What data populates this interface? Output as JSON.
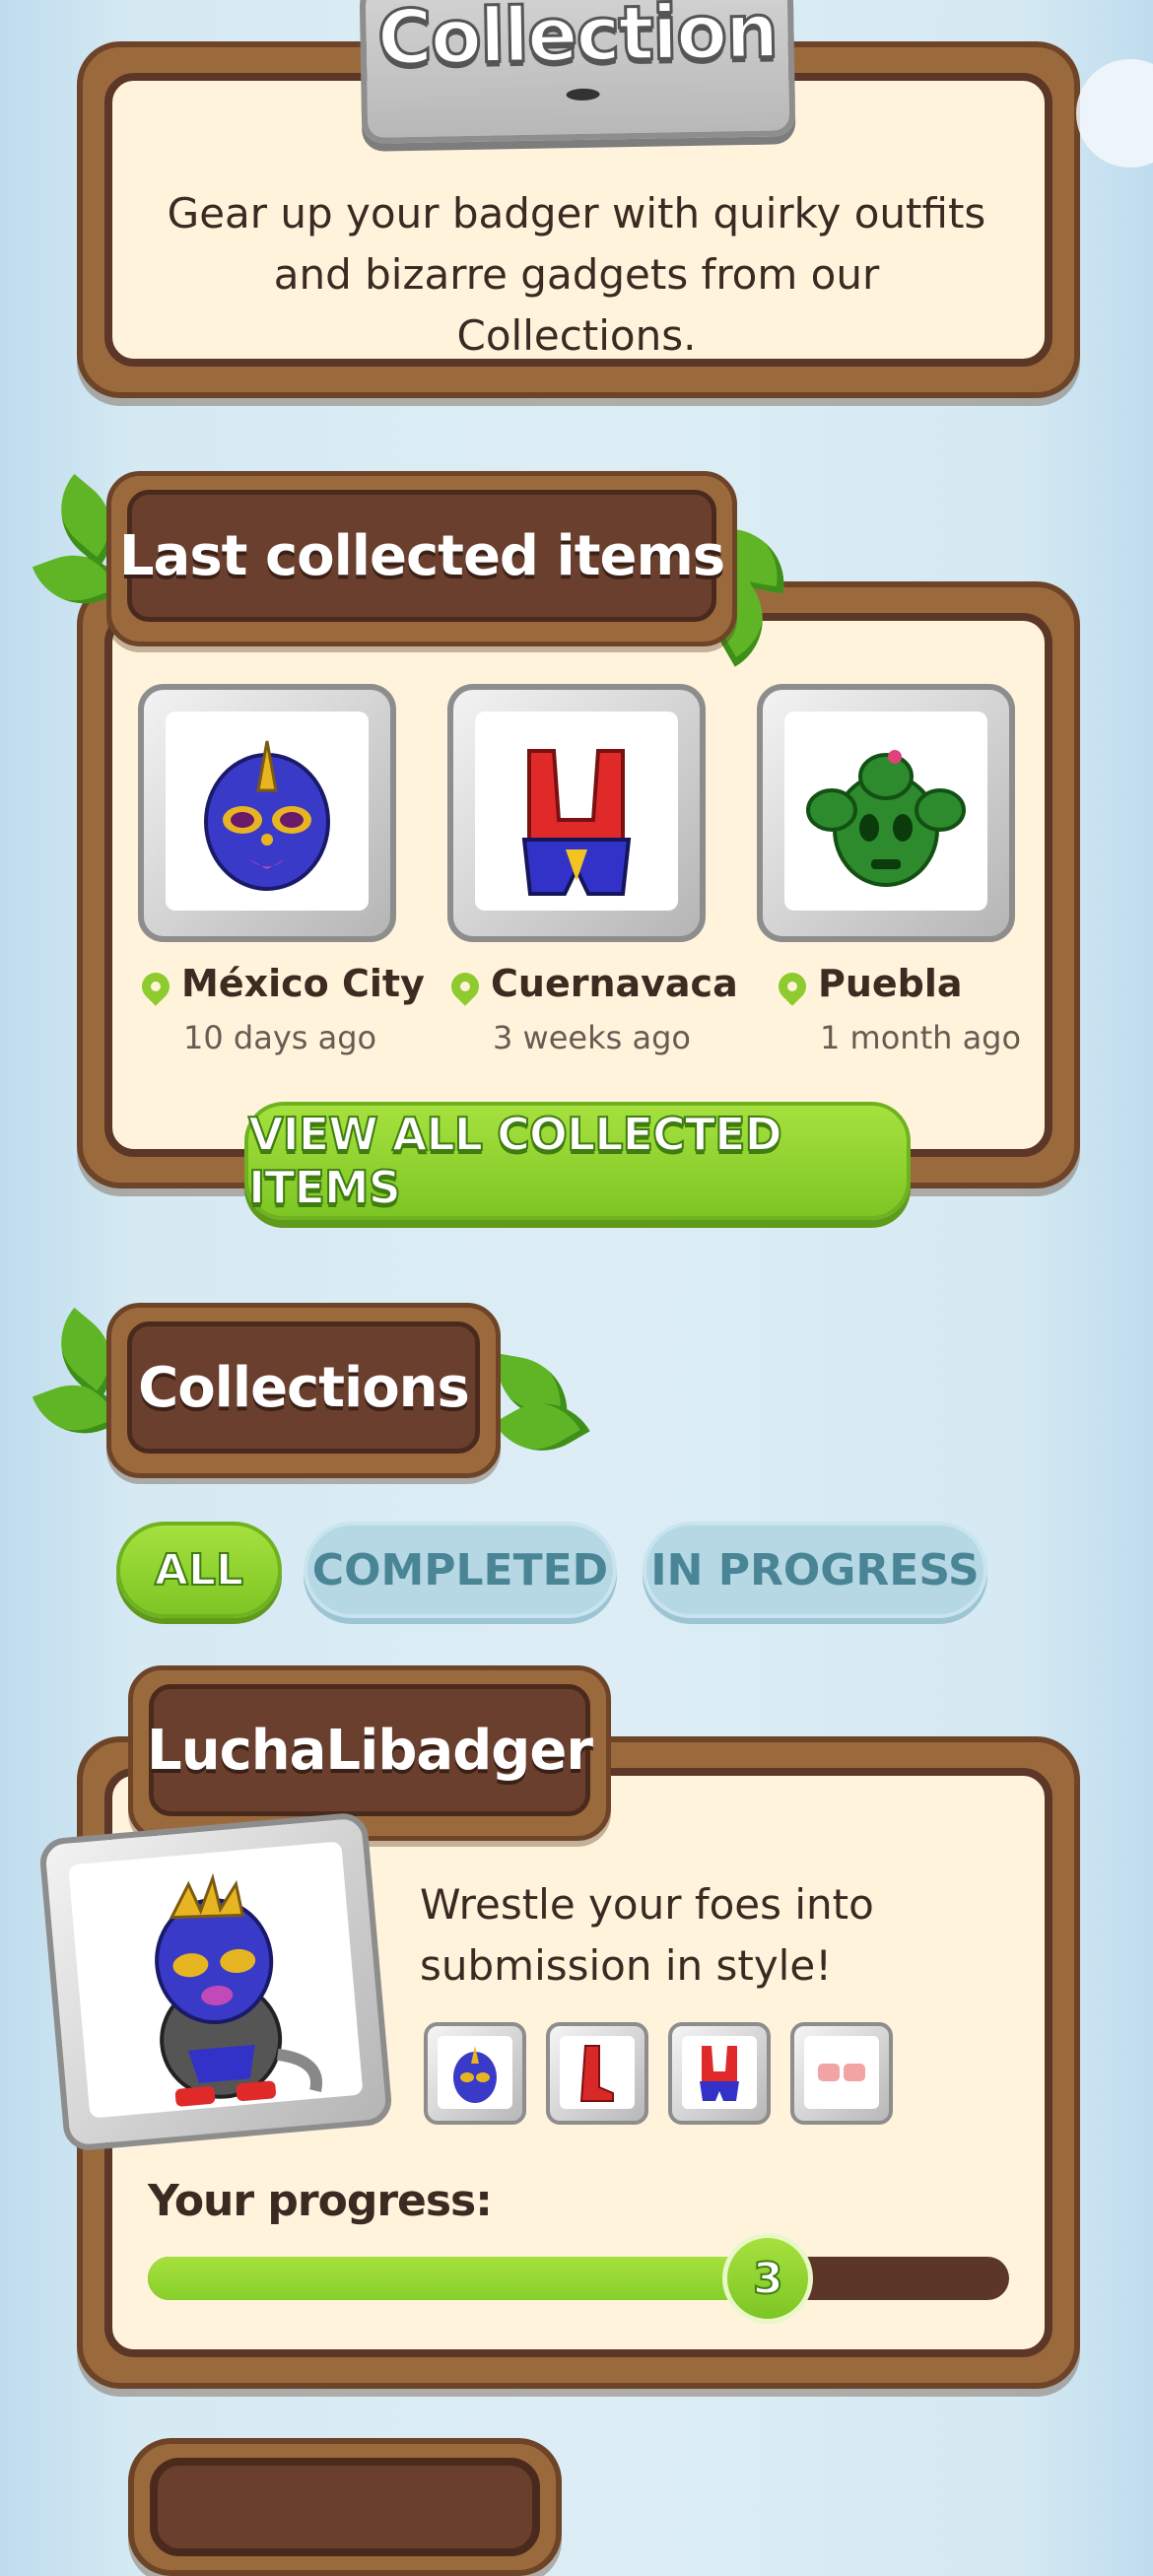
{
  "header": {
    "title": "Collection",
    "description": "Gear up your badger with quirky outfits and bizarre gadgets from our Collections."
  },
  "last_collected": {
    "title": "Last collected items",
    "items": [
      {
        "city": "México City",
        "ago": "10 days ago",
        "icon": "wrestling-mask-icon"
      },
      {
        "city": "Cuernavaca",
        "ago": "3 weeks ago",
        "icon": "wrestling-outfit-icon"
      },
      {
        "city": "Puebla",
        "ago": "1 month ago",
        "icon": "cactus-mask-icon"
      }
    ],
    "view_all_label": "VIEW ALL COLLECTED ITEMS"
  },
  "collections": {
    "title": "Collections",
    "tabs": [
      {
        "label": "ALL",
        "active": true
      },
      {
        "label": "COMPLETED",
        "active": false
      },
      {
        "label": "IN PROGRESS",
        "active": false
      }
    ]
  },
  "collection_card": {
    "name": "LuchaLibadger",
    "description": "Wrestle your foes into submission in style!",
    "items": [
      "wrestling-mask-icon",
      "red-boots-icon",
      "wrestling-outfit-icon",
      "pink-wristbands-icon"
    ],
    "progress_label": "Your progress:",
    "progress_value": "3",
    "progress_fraction": 0.72
  },
  "colors": {
    "wood": "#9b6a3c",
    "wood_dark": "#5c3626",
    "cream": "#fff3dc",
    "accent_green": "#8dcb2f",
    "sky": "#d6eaf3"
  }
}
